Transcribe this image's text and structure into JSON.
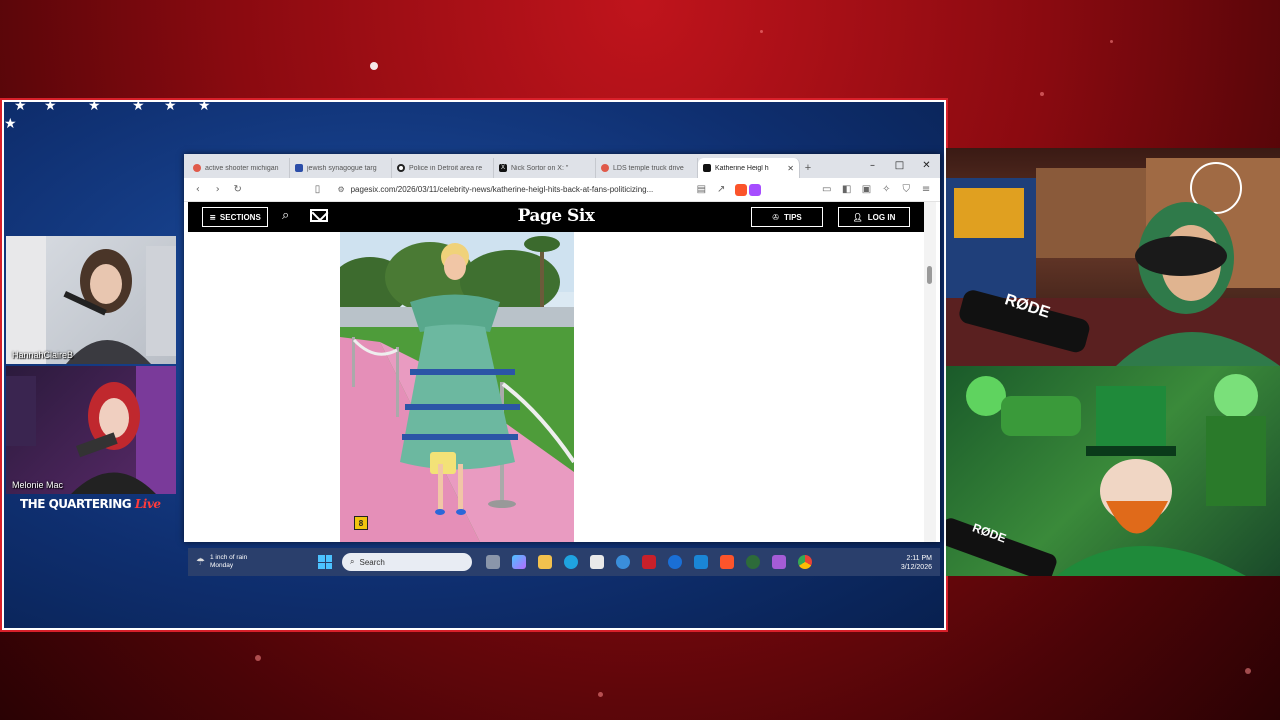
{
  "browser": {
    "tabs": [
      {
        "label": "active shooter michigan",
        "icon_color": "#e05a4a",
        "active": false
      },
      {
        "label": "jewish synagogue targ",
        "icon_color": "#2b4da8",
        "active": false
      },
      {
        "label": "Police in Detroit area re",
        "icon_color": "#222222",
        "active": false
      },
      {
        "label": "Nick Sortor on X: \"",
        "icon_color": "#111111",
        "active": false
      },
      {
        "label": "LDS temple truck drive",
        "icon_color": "#e05a4a",
        "active": false
      },
      {
        "label": "Katherine Heigl h",
        "icon_color": "#111111",
        "active": true
      }
    ],
    "new_tab": "+",
    "window_controls": {
      "minimize": "–",
      "maximize": "□",
      "close": "✕"
    },
    "url": "pagesix.com/2026/03/11/celebrity-news/katherine-heigl-hits-back-at-fans-politicizing..."
  },
  "site": {
    "sections_label": "SECTIONS",
    "logo": "Page Six",
    "tips_label": "TIPS",
    "login_label": "LOG IN",
    "gallery_count": "8"
  },
  "taskbar": {
    "weather_line1": "1 inch of rain",
    "weather_line2": "Monday",
    "search_placeholder": "Search",
    "time": "2:11 PM",
    "date": "3/12/2026"
  },
  "cams": {
    "top_left_name": "HannahClaireB",
    "bottom_left_name": "Melonie Mac",
    "mic_brand_top": "RØDE",
    "mic_brand_bottom": "RØDE"
  },
  "brand": {
    "main": "THE QUARTERING",
    "live": "Live"
  },
  "colors": {
    "background_red": "#8a0a10",
    "frame_blue": "#0f2f70",
    "taskbar": "#2a3f6c",
    "pink_carpet": "#e58fb8"
  }
}
